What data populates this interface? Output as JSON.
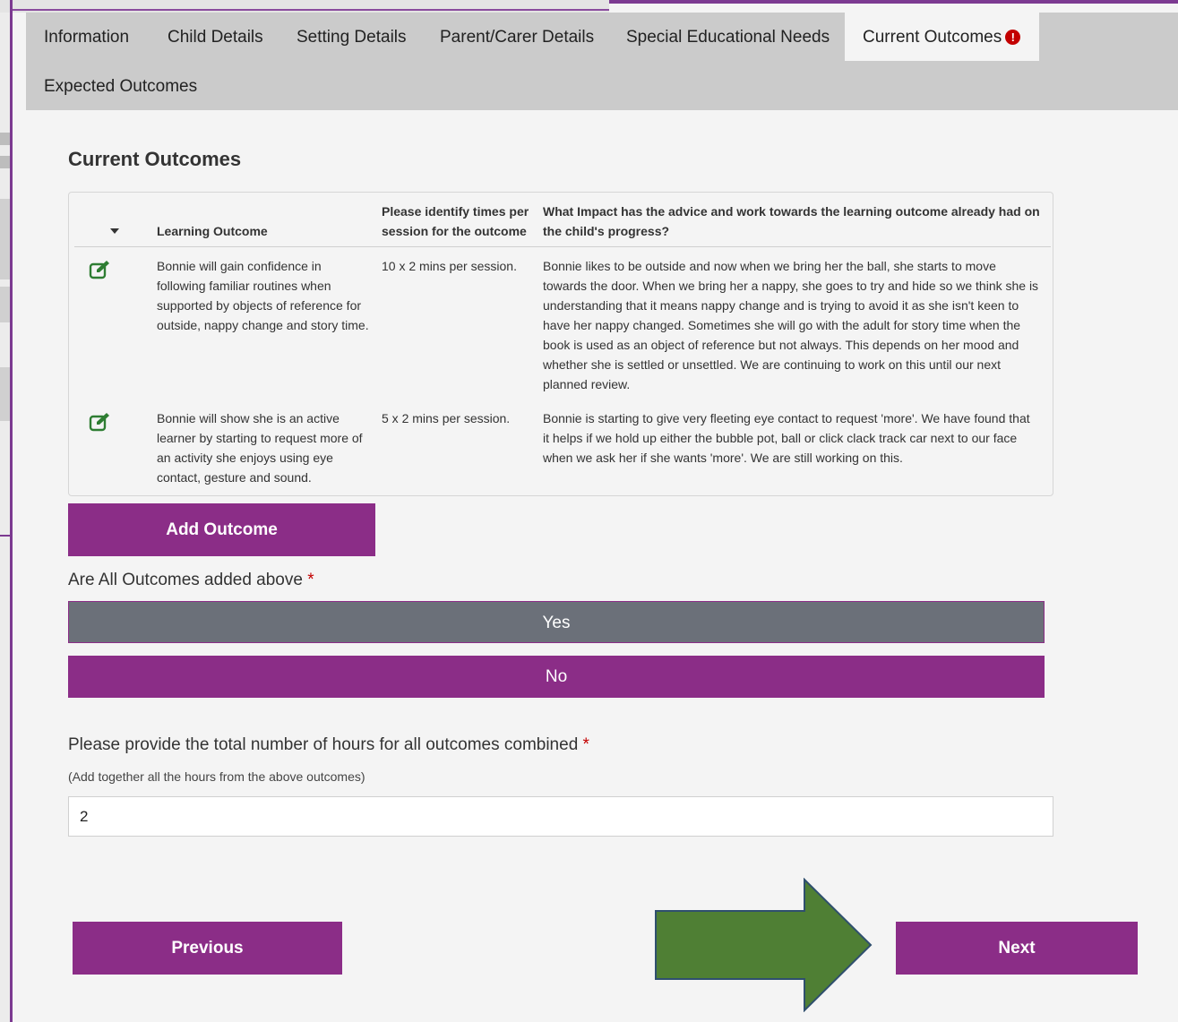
{
  "tabs": [
    {
      "label": "Information"
    },
    {
      "label": "Child Details"
    },
    {
      "label": "Setting Details"
    },
    {
      "label": "Parent/Carer Details"
    },
    {
      "label": "Special Educational Needs"
    },
    {
      "label": "Current Outcomes",
      "active": true,
      "alert": "!"
    },
    {
      "label": "Expected Outcomes"
    }
  ],
  "section_title": "Current Outcomes",
  "table": {
    "headers": {
      "learning_outcome": "Learning Outcome",
      "times_line1": "Please identify times per",
      "times_line2": "session for the outcome",
      "impact_line1": "What Impact has the advice and work towards the learning outcome already had on",
      "impact_line2": "the child's progress?"
    },
    "rows": [
      {
        "outcome": [
          "Bonnie will gain confidence in",
          "following familiar routines when",
          "supported by objects of reference for",
          "outside, nappy change and story time."
        ],
        "times": "10 x 2 mins per session.",
        "impact": [
          "Bonnie likes to be outside and now when we bring her the ball, she starts to move",
          "towards the door. When we bring her a nappy, she goes to try and hide so we think she is",
          "understanding that it means nappy change and is trying to avoid it as she isn't keen to",
          "have her nappy changed. Sometimes she will go with the adult for story time when the",
          "book is used as an object of reference but not always. This depends on her mood and",
          "whether she is settled or unsettled. We are continuing to work on this until our next",
          "planned review."
        ]
      },
      {
        "outcome": [
          "Bonnie will show she is an active",
          "learner by starting to request more of",
          "an activity she enjoys using eye",
          "contact, gesture and sound."
        ],
        "times": "5 x 2 mins per session.",
        "impact": [
          "Bonnie is starting to give very fleeting eye contact to request 'more'. We have found that",
          "it helps if we hold up either the bubble pot, ball or click clack track car next to our face",
          "when we ask her if she wants 'more'. We are still working on this."
        ]
      }
    ]
  },
  "add_outcome_label": "Add Outcome",
  "all_added_question": "Are All Outcomes added above",
  "required_mark": "*",
  "yes_label": "Yes",
  "no_label": "No",
  "hours_question": "Please provide the total number of hours for all outcomes combined",
  "hours_hint": "(Add together all the hours from the above outcomes)",
  "hours_value": "2",
  "previous_label": "Previous",
  "next_label": "Next",
  "colors": {
    "accent": "#8b2d87",
    "selected_choice": "#6b7079",
    "tabbar": "#cbcbcb",
    "alert": "#c30000",
    "edit_icon": "#2e7d32",
    "arrow": "#4f7f34"
  }
}
